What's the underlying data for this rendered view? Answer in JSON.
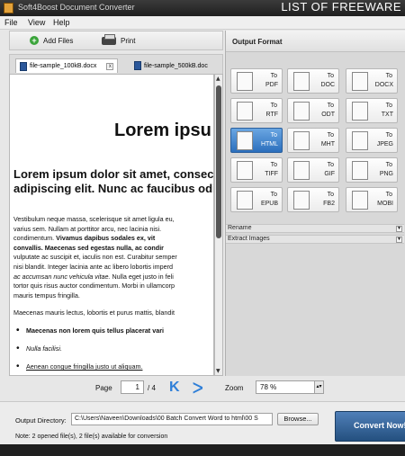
{
  "window": {
    "title": "Soft4Boost Document Converter",
    "banner": "LIST OF FREEWARE"
  },
  "menu": [
    "File",
    "View",
    "Help"
  ],
  "toolbar": {
    "add_files": "Add Files",
    "print": "Print"
  },
  "tabs": [
    {
      "label": "file-sample_100kB.docx",
      "active": true
    },
    {
      "label": "file-sample_500kB.doc",
      "active": false
    }
  ],
  "preview": {
    "heading1": "Lorem ipsu",
    "heading2": "Lorem ipsum dolor sit amet, consectetur adipiscing elit. Nunc ac faucibus odio.",
    "para_lines": [
      "Vestibulum neque massa, scelerisque sit amet ligula eu,",
      "varius sem. Nullam at porttitor arcu, nec lacinia nisi.",
      "condimentum.",
      "convallis. Maecenas sed egestas nulla, ac condir",
      "vulputate ac suscipit et, iaculis non est. Curabitur semper",
      "nisi blandit. Integer lacinia ante ac libero lobortis imperd",
      "ac accumsan nunc vehicula vitae.",
      "tortor quis risus auctor condimentum. Morbi in ullamcorp",
      "mauris tempus fringilla."
    ],
    "bold_run": "Vivamus dapibus sodales ex, vit",
    "italic_run": "ac accumsan nunc vehicula vitae.",
    "tail_run": " Nulla eget justo in feli",
    "para2": "Maecenas mauris lectus, lobortis et purus mattis, blandit",
    "bullets": [
      {
        "text": "Maecenas non lorem quis tellus placerat vari",
        "style": "bold"
      },
      {
        "text": "Nulla facilisi.",
        "style": "italic"
      },
      {
        "text": "Aenean congue fringilla justo ut aliquam.",
        "style": "underline"
      }
    ]
  },
  "pager": {
    "page_label": "Page",
    "page_value": "1",
    "page_total": "/ 4",
    "zoom_label": "Zoom",
    "zoom_value": "78 %",
    "prev_glyph": "K",
    "next_glyph": "ᐳ"
  },
  "output_format": {
    "header": "Output Format",
    "formats": [
      {
        "prefix": "To",
        "name": "PDF"
      },
      {
        "prefix": "To",
        "name": "DOC"
      },
      {
        "prefix": "To",
        "name": "DOCX"
      },
      {
        "prefix": "To",
        "name": "RTF"
      },
      {
        "prefix": "To",
        "name": "ODT"
      },
      {
        "prefix": "To",
        "name": "TXT"
      },
      {
        "prefix": "To",
        "name": "HTML",
        "active": true
      },
      {
        "prefix": "To",
        "name": "MHT"
      },
      {
        "prefix": "To",
        "name": "JPEG"
      },
      {
        "prefix": "To",
        "name": "TIFF"
      },
      {
        "prefix": "To",
        "name": "GIF"
      },
      {
        "prefix": "To",
        "name": "PNG"
      },
      {
        "prefix": "To",
        "name": "EPUB"
      },
      {
        "prefix": "To",
        "name": "FB2"
      },
      {
        "prefix": "To",
        "name": "MOBI"
      }
    ],
    "sections": [
      "Rename",
      "Extract Images"
    ]
  },
  "bottom": {
    "output_label": "Output Directory:",
    "output_path": "C:\\Users\\Naveen\\Downloads\\00 Batch Convert Word to html\\00 S",
    "browse": "Browse...",
    "note": "Note: 2 opened file(s), 2 file(s) available for conversion",
    "convert": "Convert Now!"
  },
  "colors": {
    "accent": "#2b6fbd",
    "convert": "#24507f"
  }
}
